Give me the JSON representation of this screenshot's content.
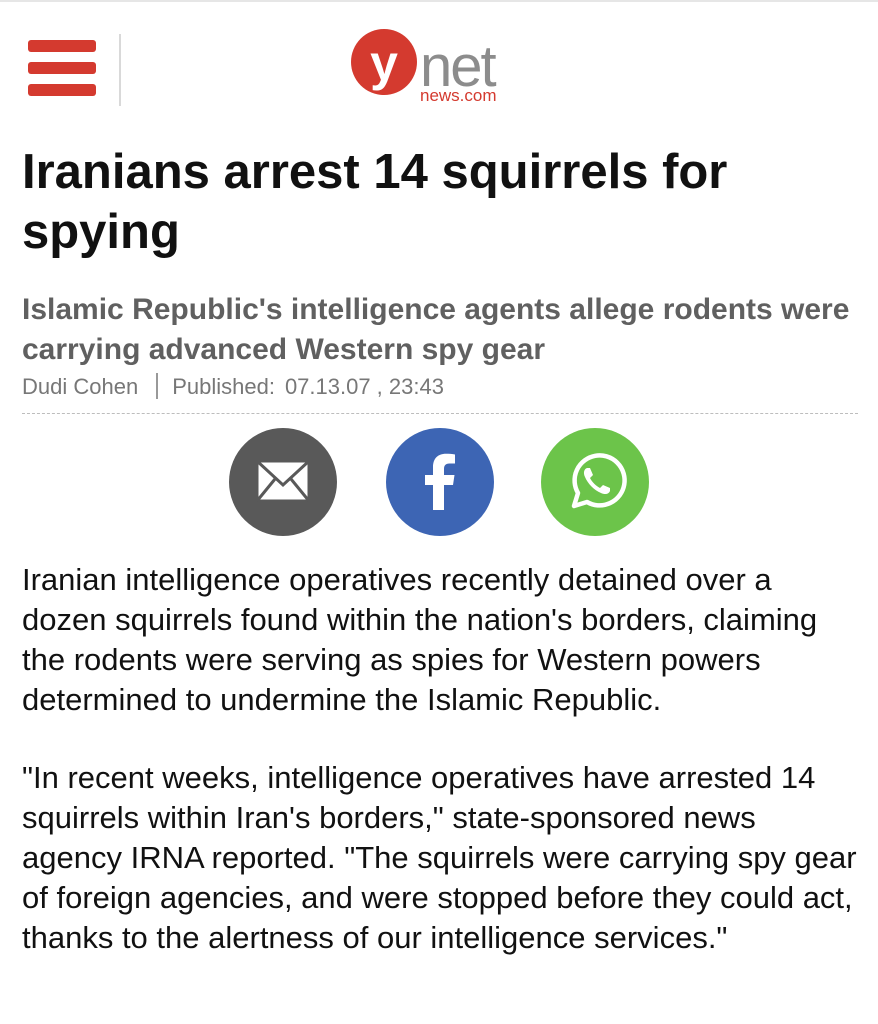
{
  "header": {
    "menu_icon": "hamburger-menu-icon",
    "logo_y": "y",
    "logo_net": "net",
    "logo_domain": "news.com",
    "logo_accent_color": "#d43a2f"
  },
  "article": {
    "headline": "Iranians arrest 14 squirrels for spying",
    "subheadline": "Islamic Republic's intelligence agents allege rodents were carrying advanced Western spy gear",
    "author": "Dudi Cohen",
    "published_label": "Published:",
    "published_date": "07.13.07 , 23:43",
    "paragraphs": [
      "Iranian intelligence operatives recently detained over a dozen squirrels found within the nation's borders, claiming the rodents were serving as spies for Western powers determined to undermine the Islamic Republic.",
      "\"In recent weeks, intelligence operatives have arrested 14 squirrels within Iran's borders,\" state-sponsored news agency IRNA reported. \"The squirrels were carrying spy gear of foreign agencies, and were stopped before they could act, thanks to the alertness of our intelligence services.\""
    ]
  },
  "share": {
    "buttons": [
      {
        "icon": "envelope-icon",
        "color": "#595959"
      },
      {
        "icon": "facebook-icon",
        "color": "#3d65b4"
      },
      {
        "icon": "whatsapp-icon",
        "color": "#6cc44a"
      }
    ]
  }
}
